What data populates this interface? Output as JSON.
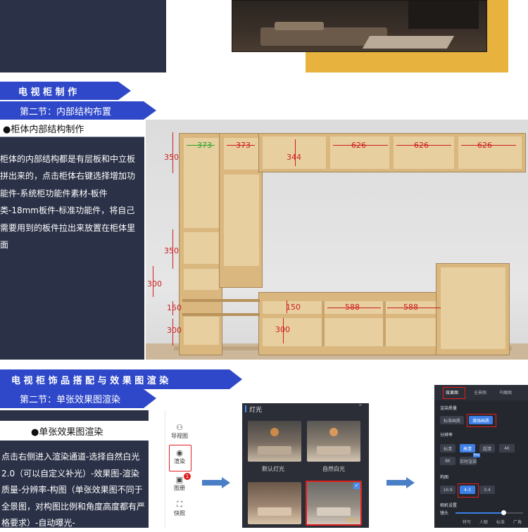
{
  "section1": {
    "ribbon_main": "电 视 柜 制 作",
    "ribbon_sub": "第二节：内部结构布置",
    "bullet_title": "●柜体内部结构制作",
    "body_text": "柜体的内部结构都是有层板和中立板拼出来的，点击柜体右键选择增加功能件-系统柜功能件素材-板件类-18mm板件-标准功能件，将自己需要用到的板件拉出来放置在柜体里面",
    "dimensions": {
      "d373a": "373",
      "d373b": "373",
      "d344": "344",
      "d626a": "626",
      "d626b": "626",
      "d626c": "626",
      "d350a": "350",
      "d350b": "350",
      "d300a": "300",
      "d150a": "150",
      "d300b": "300",
      "d150b": "150",
      "d588a": "588",
      "d588b": "588",
      "d300c": "300"
    }
  },
  "section2": {
    "ribbon_main": "电 视 柜 饰 品 搭 配 与 效 果 图 渲 染",
    "ribbon_sub": "第二节：单张效果图渲染",
    "bullet_title": "●单张效果图渲染",
    "body_text": "点击右侧进入渲染通道-选择自然白光2.0（可以自定义补光）-效果图-渲染质量-分辨率-构图（单张效果图不同于全景图，对构图比例和角度高度都有严格要求）-自动曝光-"
  },
  "toolbar": {
    "nav_label": "导视图",
    "render_label": "渲染",
    "album_label": "图册",
    "album_badge": "1",
    "snapshot_label": "快照"
  },
  "lighting": {
    "title": "灯光",
    "default_label": "默认灯光",
    "natural_label": "自然白光",
    "beta_badge": "Beta"
  },
  "render_panel": {
    "tabs": [
      "效果图",
      "全景图",
      "鸟瞰图"
    ],
    "quality_title": "渲染质量",
    "quality_options": [
      "标准画质",
      "增强画质"
    ],
    "resolution_title": "分辨率",
    "resolution_options": [
      "标清",
      "高清",
      "超清",
      "4K",
      "8K",
      "实时渲染"
    ],
    "pro_badge": "Pro",
    "composition_title": "构图",
    "composition_options": [
      "16:9",
      "4:3",
      "3:4"
    ],
    "camera_title": "相机设置",
    "lens_label": "镜头",
    "lens_marks": [
      "特写",
      "人眼",
      "标准",
      "广角"
    ]
  },
  "colors": {
    "navy": "#2b3147",
    "ribbon_blue": "#2f48c9",
    "gold": "#e8b23f",
    "wood": "#d9b77e",
    "dimension_red": "#cc1f1f",
    "arrow_blue": "#4a7fc6",
    "highlight_red": "#e02020"
  }
}
